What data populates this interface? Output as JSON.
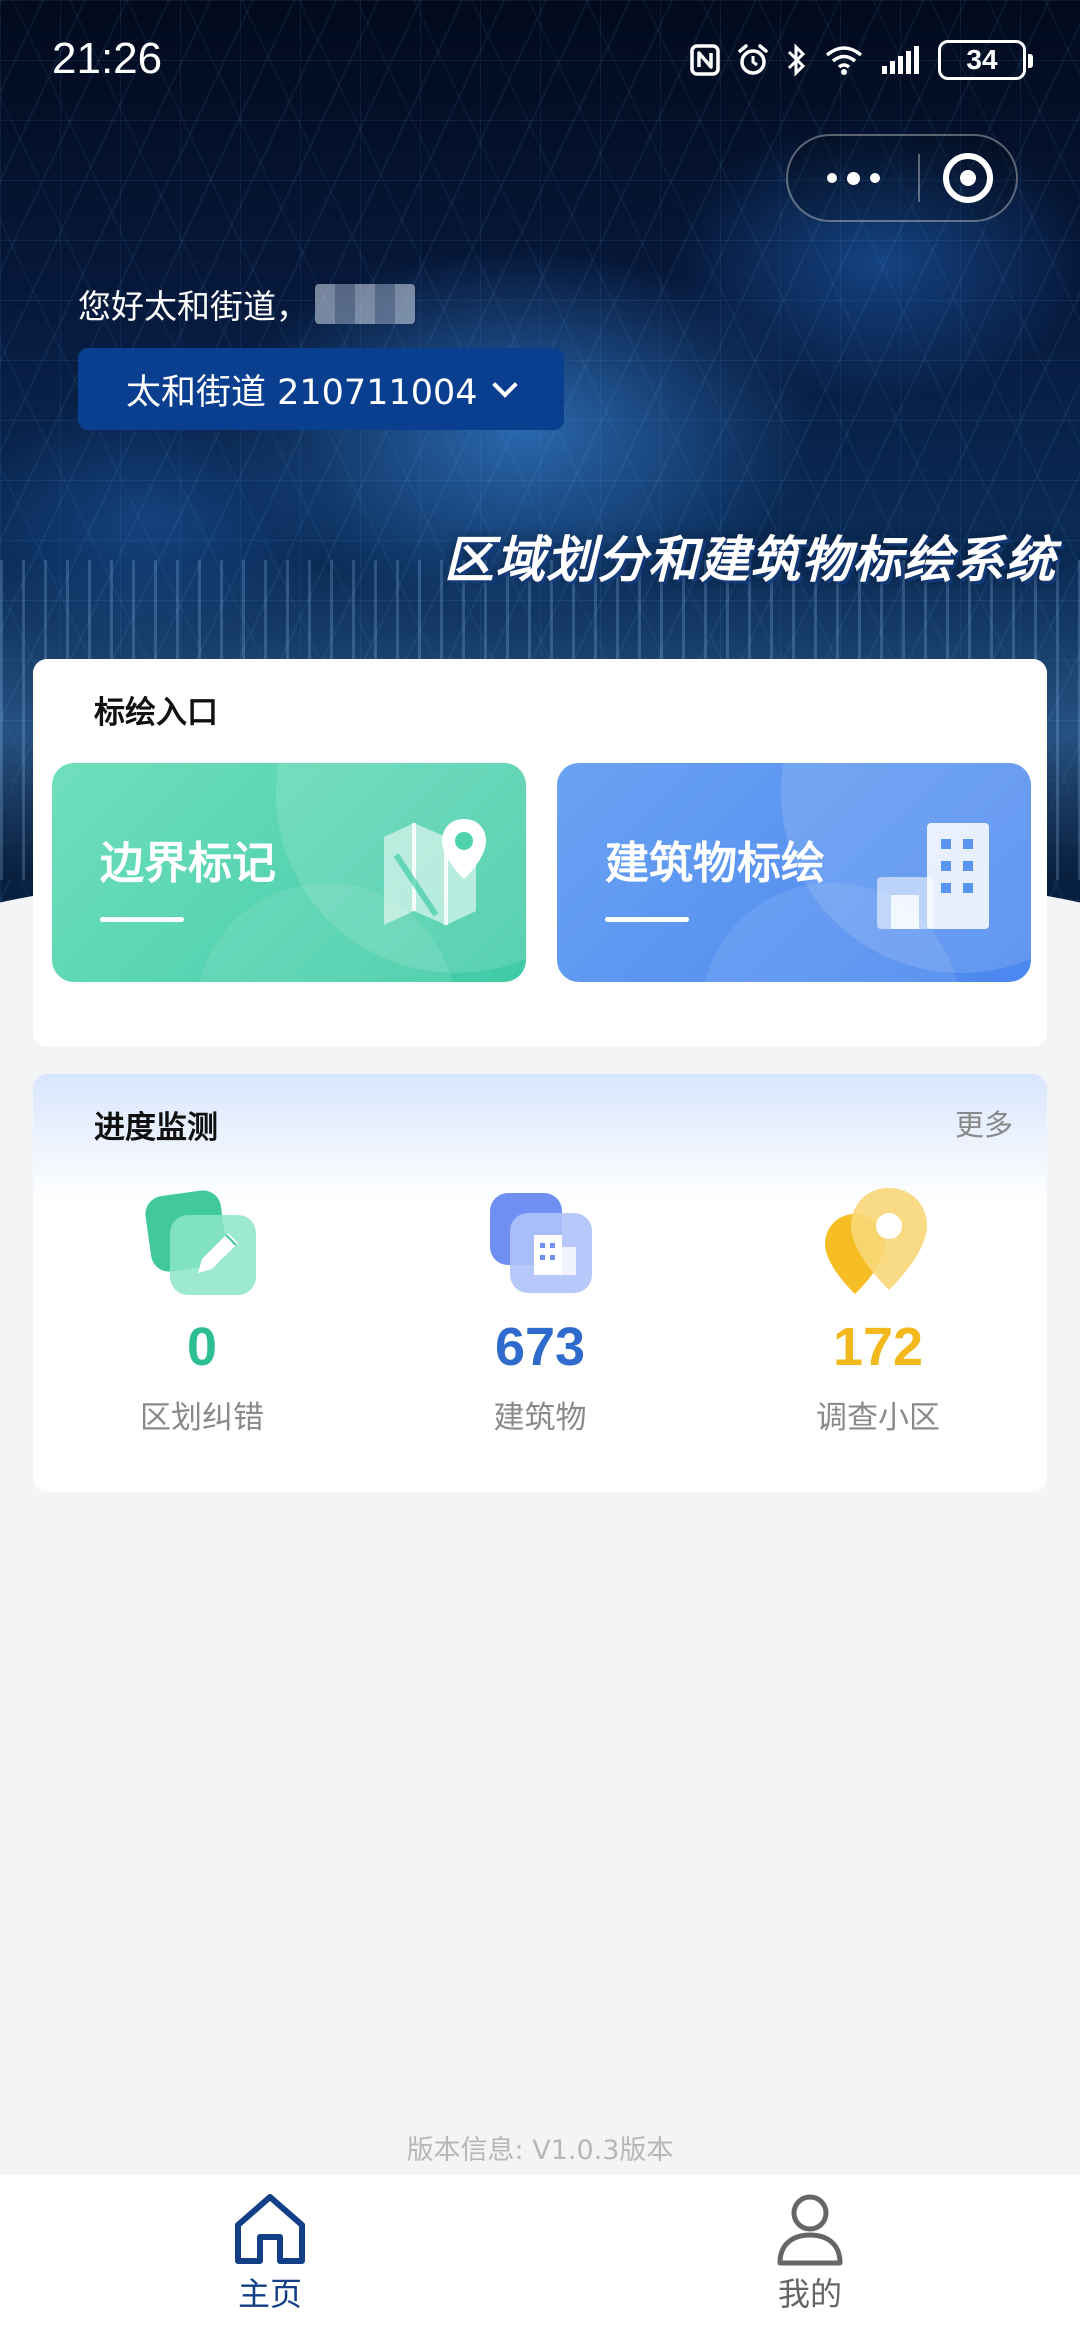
{
  "status_bar": {
    "time": "21:26",
    "battery": "34",
    "icons": [
      "nfc-icon",
      "alarm-icon",
      "bluetooth-icon",
      "wifi-icon",
      "signal-icon",
      "battery-icon"
    ]
  },
  "header": {
    "greeting": "您好太和街道，",
    "street_selector": "太和街道 210711004",
    "system_title": "区域划分和建筑物标绘系统"
  },
  "entry": {
    "title": "标绘入口",
    "tiles": [
      {
        "label": "边界标记",
        "icon": "map-pin-icon",
        "color": "#4fd2ae"
      },
      {
        "label": "建筑物标绘",
        "icon": "building-icon",
        "color": "#5b95f0"
      }
    ]
  },
  "progress": {
    "title": "进度监测",
    "more": "更多",
    "stats": [
      {
        "value": "0",
        "label": "区划纠错",
        "icon": "edit-icon",
        "color": "#2dbe94"
      },
      {
        "value": "673",
        "label": "建筑物",
        "icon": "building-icon",
        "color": "#2f6bcc"
      },
      {
        "value": "172",
        "label": "调查小区",
        "icon": "location-icon",
        "color": "#f2b81c"
      }
    ]
  },
  "footer": {
    "version": "版本信息: V1.0.3版本"
  },
  "tabbar": {
    "items": [
      {
        "label": "主页",
        "icon": "home-icon",
        "active": true
      },
      {
        "label": "我的",
        "icon": "user-icon",
        "active": false
      }
    ]
  },
  "colors": {
    "accent": "#123f86",
    "selector_bg": "#0a3f8f",
    "page_bg": "#f3f4f6"
  }
}
